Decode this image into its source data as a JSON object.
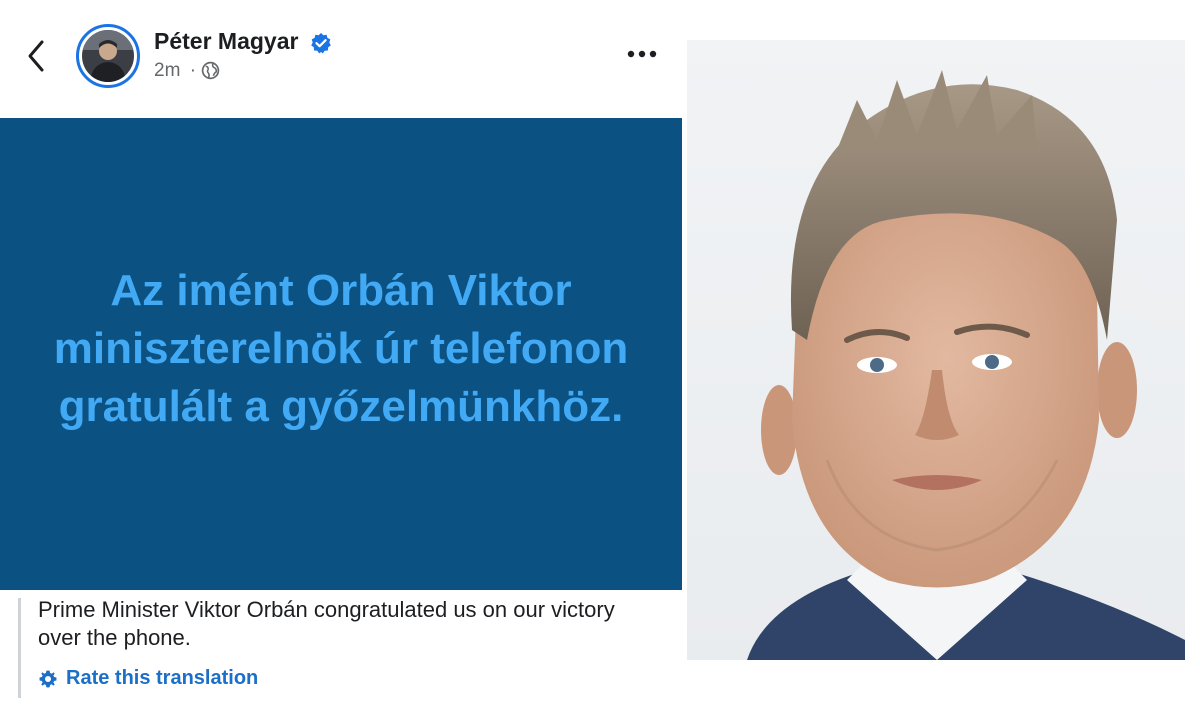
{
  "post": {
    "author": "Péter Magyar",
    "age": "2m",
    "separator": "·",
    "card_text": "Az imént Orbán Viktor miniszterelnök úr telefonon gratulált a győzelmünkhöz.",
    "translation": "Prime Minister Viktor Orbán congratulated us on our victory over the phone.",
    "rate_label": "Rate this translation"
  },
  "colors": {
    "card_bg": "#0b5182",
    "card_text": "#42aaf5",
    "accent": "#1b74e4",
    "link": "#1b6fc9"
  },
  "icons": [
    "back-arrow-icon",
    "verified-badge-icon",
    "globe-icon",
    "more-options-icon",
    "gear-icon"
  ]
}
